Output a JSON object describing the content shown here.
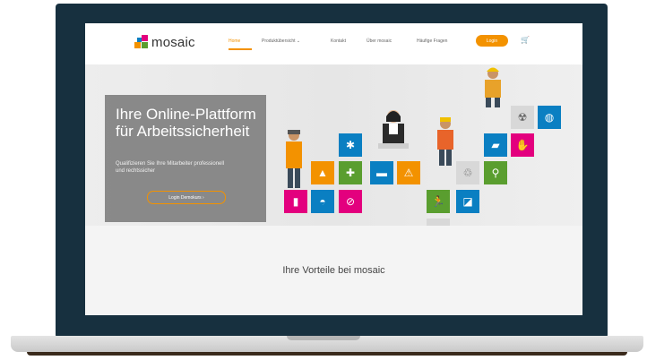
{
  "nav": {
    "logo_text": "mosaic",
    "items": [
      "Home",
      "Produktübersicht ⌄",
      "Kontakt",
      "Über mosaic",
      "Häufige Fragen"
    ],
    "cta": "Login",
    "cart_icon": "cart-icon"
  },
  "hero": {
    "title_line1": "Ihre Online-Plattform",
    "title_line2": "für Arbeitssicherheit",
    "subtitle": "Qualifizieren Sie Ihre Mitarbeiter professionell und rechtssicher",
    "button": "Login Demokurs ›"
  },
  "section": {
    "title": "Ihre Vorteile bei mosaic"
  },
  "colors": {
    "accent": "#f39200",
    "lid": "#17303f"
  }
}
